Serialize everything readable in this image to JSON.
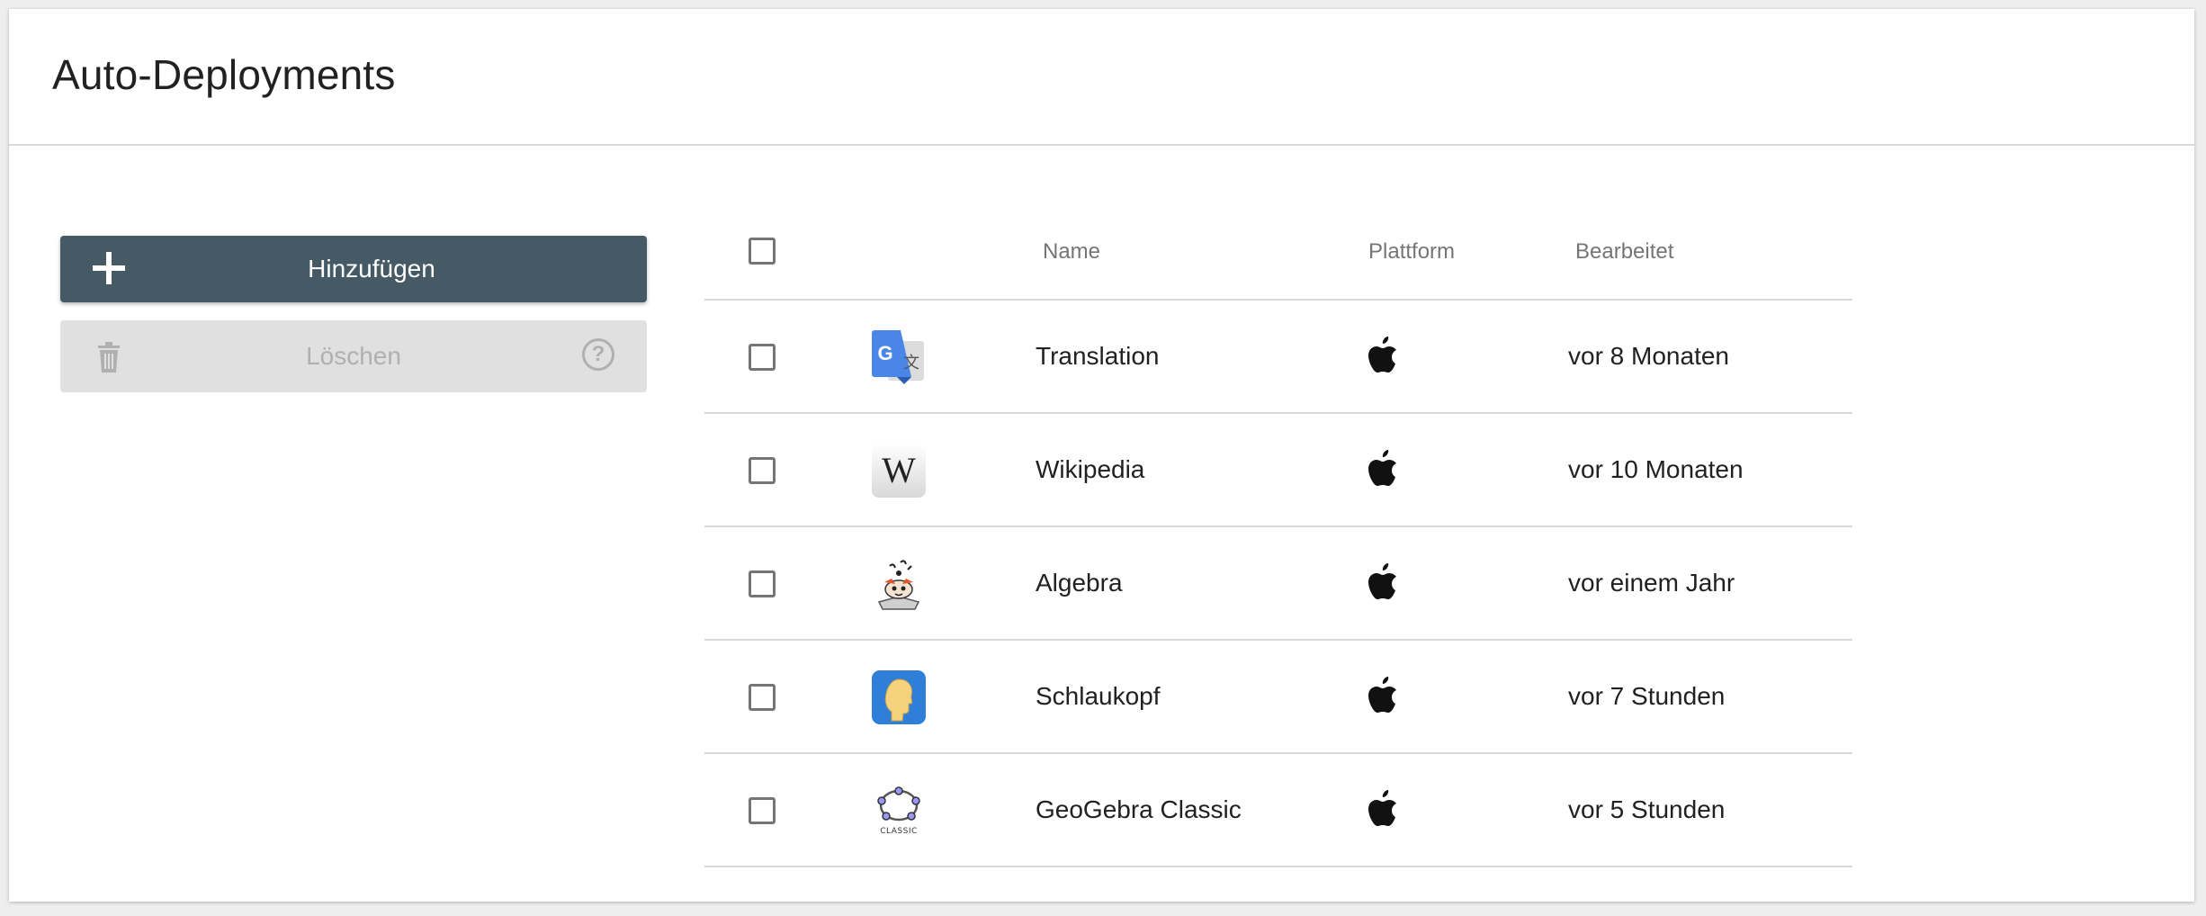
{
  "page": {
    "title": "Auto-Deployments"
  },
  "actions": {
    "add_label": "Hinzufügen",
    "delete_label": "Löschen",
    "help_glyph": "?"
  },
  "table": {
    "headers": {
      "name": "Name",
      "platform": "Plattform",
      "edited": "Bearbeitet"
    },
    "rows": [
      {
        "name": "Translation",
        "platform_icon": "apple-icon",
        "app_icon": "google-translate-icon",
        "edited": "vor 8 Monaten"
      },
      {
        "name": "Wikipedia",
        "platform_icon": "apple-icon",
        "app_icon": "wikipedia-icon",
        "edited": "vor 10 Monaten"
      },
      {
        "name": "Algebra",
        "platform_icon": "apple-icon",
        "app_icon": "algebra-icon",
        "edited": "vor einem Jahr"
      },
      {
        "name": "Schlaukopf",
        "platform_icon": "apple-icon",
        "app_icon": "schlaukopf-icon",
        "edited": "vor 7 Stunden"
      },
      {
        "name": "GeoGebra Classic",
        "platform_icon": "apple-icon",
        "app_icon": "geogebra-icon",
        "edited": "vor 5 Stunden",
        "icon_caption": "CLASSIC"
      }
    ]
  },
  "colors": {
    "primary_button": "#455a64",
    "disabled_button": "#e0e0e0",
    "divider": "#d9d9d9"
  }
}
